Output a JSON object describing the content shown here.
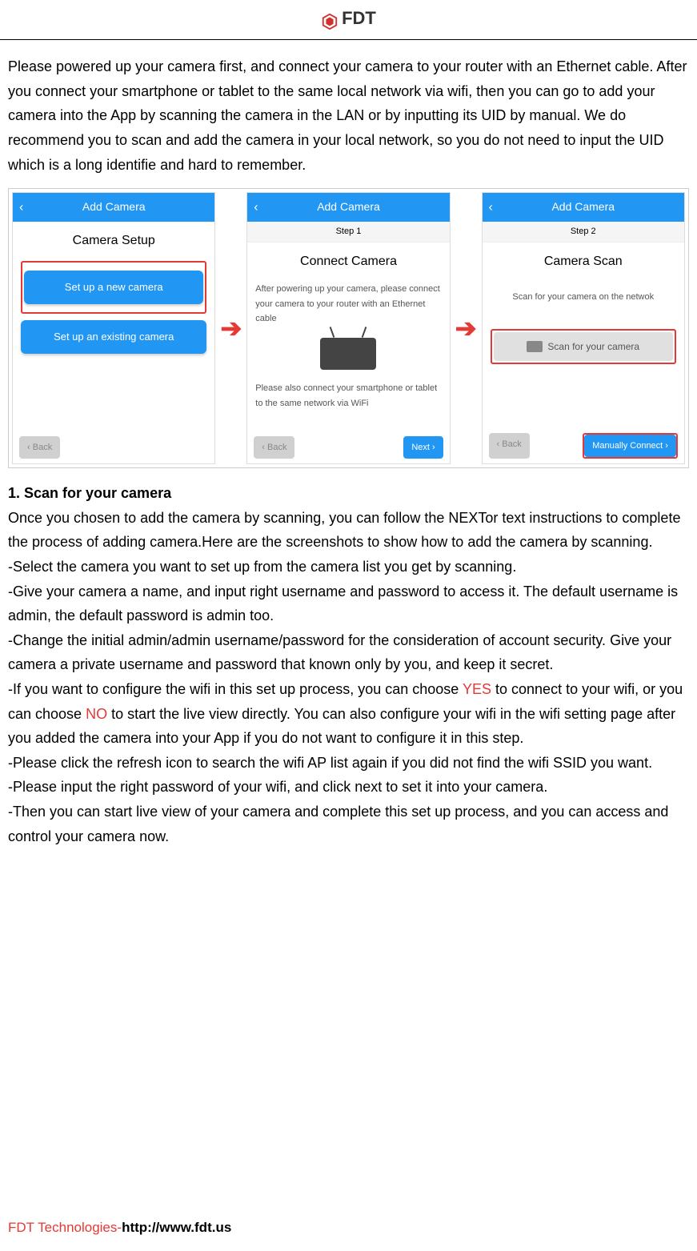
{
  "header": {
    "brand": "FDT"
  },
  "intro": "Please powered up your camera first, and connect your camera to your router with an Ethernet cable. After you connect your smartphone or tablet to the same local network via wifi, then you can go to add your camera into the App by scanning the camera in the LAN or by inputting its UID by manual. We do recommend you to scan and add the camera in your local network, so you do not need to input the UID which is a long identifie and hard to remember.",
  "screens": {
    "s1": {
      "topbar": "Add Camera",
      "title": "Camera Setup",
      "btn1": "Set up a new camera",
      "btn2": "Set up an existing camera",
      "back": "Back"
    },
    "s2": {
      "topbar": "Add Camera",
      "step": "Step 1",
      "title": "Connect Camera",
      "desc1": "After powering up your camera, please connect your camera to your router with an Ethernet cable",
      "desc2": "Please also connect your smartphone or tablet to the same network via WiFi",
      "back": "Back",
      "next": "Next"
    },
    "s3": {
      "topbar": "Add Camera",
      "step": "Step 2",
      "title": "Camera Scan",
      "desc": "Scan for your camera on the netwok",
      "scan": "Scan for your camera",
      "back": "Back",
      "manual": "Manually Connect"
    }
  },
  "section1": {
    "heading": "1. Scan for your camera",
    "p1": "Once you chosen to add the camera by scanning, you can follow the NEXTor text instructions to complete the process of adding camera.Here are the screenshots to show how to add the camera by scanning.",
    "li1": "-Select the camera you want to set up from the camera list you get by scanning.",
    "li2": "-Give your camera a name, and input right username and password to access it. The default username is admin, the default password is admin too.",
    "li3": "-Change the initial admin/admin username/password for the consideration of account security. Give your camera a private username and password that known only by you, and keep it secret.",
    "li4a": "-If you want to configure the wifi in this set up process, you can choose ",
    "li4yes": "YES",
    "li4b": " to connect to your wifi, or you can choose ",
    "li4no": "NO",
    "li4c": " to start the live view directly. You can also configure your wifi in the wifi setting page after you added the camera into your App if you do not want to configure it in this step.",
    "li5": "-Please click the refresh icon to search the wifi AP list again if you did not find the wifi SSID you want.",
    "li6": "-Please input the right password of your wifi, and click next to set it into your camera.",
    "li7": "-Then you can start live view of your camera and complete this set up process, and you can access and control your camera now."
  },
  "footer": {
    "company": "FDT Technologies-",
    "url": "http://www.fdt.us"
  }
}
